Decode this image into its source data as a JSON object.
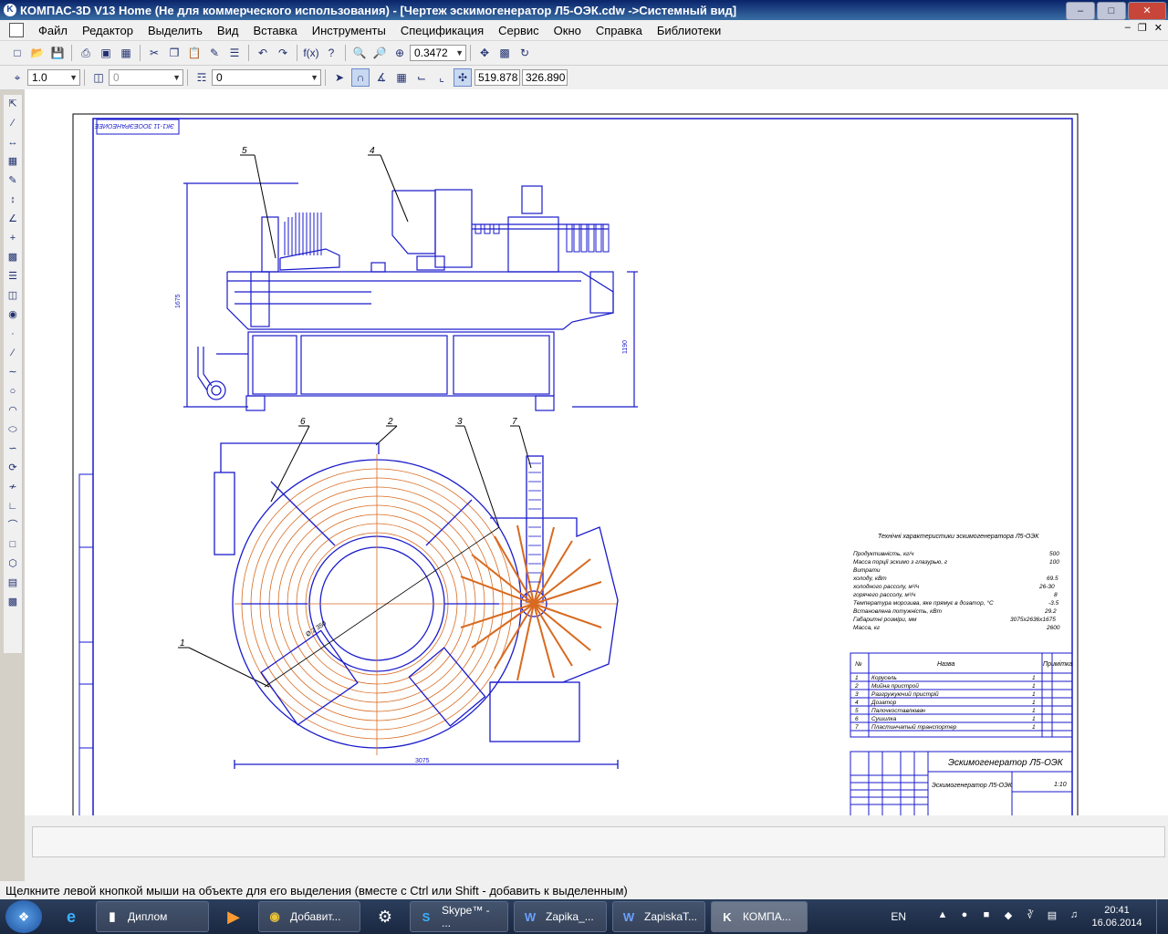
{
  "window": {
    "title": "КОМПАС-3D V13 Home (Не для коммерческого использования) - [Чертеж эскимогенератор Л5-ОЭК.cdw ->Системный вид]"
  },
  "menu": [
    "Файл",
    "Редактор",
    "Выделить",
    "Вид",
    "Вставка",
    "Инструменты",
    "Спецификация",
    "Сервис",
    "Окно",
    "Справка",
    "Библиотеки"
  ],
  "toolbar": {
    "zoom": "0.3472"
  },
  "toolbar2": {
    "scale": "1.0",
    "layer_state": "0",
    "style": "0",
    "coord_x": "519.878",
    "coord_y": "326.890"
  },
  "drawing": {
    "stamp_rotated": "ЭК1-11 ЗООЕЭРАНЕОИЕЕ",
    "callouts": [
      "5",
      "4",
      "6",
      "2",
      "3",
      "7",
      "1"
    ],
    "dims": {
      "height_total": "1675",
      "height_right": "1190",
      "width_bottom": "3075",
      "diameter": "Ø 2 350"
    },
    "specs_title": "Технічні характеристики эскимогенератора Л5-ОЭК",
    "specs": [
      {
        "label": "Продуктивність, кг/ч",
        "value": "500"
      },
      {
        "label": "Масса порції эскимо з глазурью, г",
        "value": "100"
      },
      {
        "label": "Витрати",
        "value": ""
      },
      {
        "label": "холоду, кВт",
        "value": "69.5"
      },
      {
        "label": "холодного рассолу, м³/ч",
        "value": "26-30"
      },
      {
        "label": "горячего рассолу, м³/ч",
        "value": "8"
      },
      {
        "label": "Температура морозива, яке прямує в дозатор, °С",
        "value": "-3.5"
      },
      {
        "label": "Встановлена потужність, кВт",
        "value": "29.2"
      },
      {
        "label": "Габаритні розміри, мм",
        "value": "3075х2636х1675"
      },
      {
        "label": "Масса, кг",
        "value": "2600"
      }
    ],
    "parts_header": {
      "num": "№",
      "name": "Назва",
      "note": "Примітка"
    },
    "parts": [
      {
        "num": "1",
        "name": "Корусель",
        "qty": "1"
      },
      {
        "num": "2",
        "name": "Мийна пристрой",
        "qty": "1"
      },
      {
        "num": "3",
        "name": "Разгружуючий пристрій",
        "qty": "1"
      },
      {
        "num": "4",
        "name": "Дозатор",
        "qty": "1"
      },
      {
        "num": "5",
        "name": "Палочкоставлювач",
        "qty": "1"
      },
      {
        "num": "6",
        "name": "Сушилка",
        "qty": "1"
      },
      {
        "num": "7",
        "name": "Пластинчатый транспортер",
        "qty": "1"
      }
    ],
    "title_block": {
      "name": "Эскимогенератор Л5-ОЭК",
      "sub": "Эскимогенератор Л5-ОЭК",
      "scale": "1:10"
    }
  },
  "status": "Щелкните левой кнопкой мыши на объекте для его выделения (вместе с Ctrl или Shift - добавить к выделенным)",
  "taskbar": {
    "tasks": [
      "Диплом",
      "Добавит...",
      "Skype™ - ...",
      "Zapika_...",
      "ZapiskaT...",
      "КОМПА..."
    ],
    "lang": "EN",
    "time": "20:41",
    "date": "16.06.2014"
  }
}
